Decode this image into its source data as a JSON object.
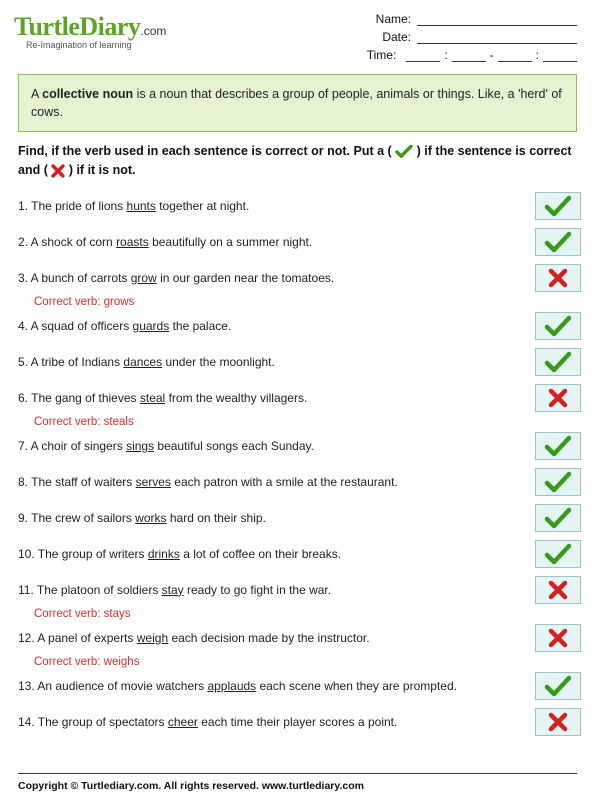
{
  "logo": {
    "brand": "TurtleDiary",
    "tld": ".com",
    "tagline": "Re-Imagination of learning"
  },
  "meta": {
    "name_label": "Name:",
    "date_label": "Date:",
    "time_label": "Time:"
  },
  "rule": {
    "pre": "A ",
    "term": "collective noun",
    "post": " is a noun that describes a group of people, animals or things. Like, a 'herd' of cows."
  },
  "instructions": {
    "p1": "Find, if the verb used in each sentence is correct or not. Put a (",
    "p2": ") if the sentence is correct and (",
    "p3": ") if it is not."
  },
  "questions": [
    {
      "n": "1.",
      "pre": "The pride of lions ",
      "verb": "hunts",
      "post": " together at night.",
      "answer": "check",
      "correction": ""
    },
    {
      "n": "2.",
      "pre": "A shock of corn ",
      "verb": "roasts",
      "post": " beautifully on a summer night.",
      "answer": "check",
      "correction": ""
    },
    {
      "n": "3.",
      "pre": "A bunch of carrots  ",
      "verb": "grow",
      "post": " in our garden near the tomatoes.",
      "answer": "cross",
      "correction": "Correct verb: grows"
    },
    {
      "n": "4.",
      "pre": "A squad of officers ",
      "verb": "guards",
      "post": " the palace.",
      "answer": "check",
      "correction": ""
    },
    {
      "n": "5.",
      "pre": "A tribe of Indians ",
      "verb": "dances",
      "post": " under the moonlight.",
      "answer": "check",
      "correction": ""
    },
    {
      "n": "6.",
      "pre": "The gang of thieves ",
      "verb": "steal",
      "post": " from the wealthy villagers.",
      "answer": "cross",
      "correction": "Correct verb: steals"
    },
    {
      "n": "7.",
      "pre": "A choir of singers ",
      "verb": "sings",
      "post": " beautiful songs each Sunday.",
      "answer": "check",
      "correction": ""
    },
    {
      "n": "8.",
      "pre": "The staff of waiters ",
      "verb": "serves",
      "post": "  each patron with a smile at the restaurant.",
      "answer": "check",
      "correction": ""
    },
    {
      "n": "9.",
      "pre": "The crew of sailors ",
      "verb": "works",
      "post": " hard on their ship.",
      "answer": "check",
      "correction": ""
    },
    {
      "n": "10.",
      "pre": " The group of writers  ",
      "verb": "drinks",
      "post": " a lot of coffee on their breaks.",
      "answer": "check",
      "correction": ""
    },
    {
      "n": "11.",
      "pre": " The platoon of soldiers ",
      "verb": "stay",
      "post": " ready to go fight in the war.",
      "answer": "cross",
      "correction": "Correct verb: stays"
    },
    {
      "n": "12.",
      "pre": " A panel of experts ",
      "verb": "weigh",
      "post": " each decision made by the instructor.",
      "answer": "cross",
      "correction": "Correct verb: weighs"
    },
    {
      "n": "13.",
      "pre": "  An audience of movie watchers ",
      "verb": "applauds",
      "post": " each scene when they are prompted.",
      "answer": "check",
      "correction": ""
    },
    {
      "n": "14.",
      "pre": "  The group of spectators ",
      "verb": "cheer",
      "post": " each time their player scores a point.",
      "answer": "cross",
      "correction": ""
    }
  ],
  "footer": "Copyright © Turtlediary.com. All rights reserved.   www.turtlediary.com"
}
